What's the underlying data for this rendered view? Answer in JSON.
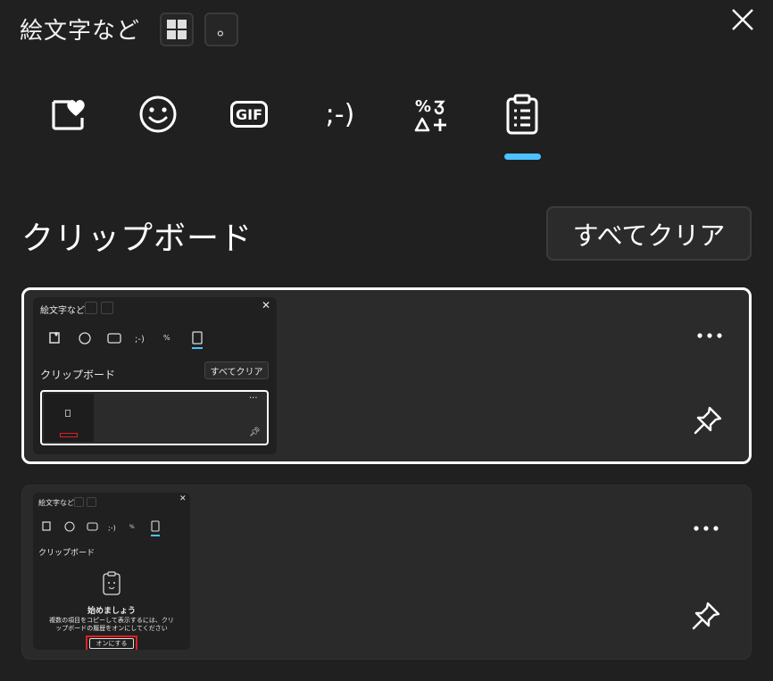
{
  "header": {
    "title": "絵文字など",
    "mode_button_2_glyph": "。"
  },
  "tabs": [
    {
      "name": "kaomoji-favorite",
      "icon": "heart-sticker-icon"
    },
    {
      "name": "emoji",
      "icon": "smiley-icon"
    },
    {
      "name": "gif",
      "icon": "gif-icon",
      "label": "GIF"
    },
    {
      "name": "kaomoji",
      "icon": "kaomoji-icon",
      "label": ";-)"
    },
    {
      "name": "symbols",
      "icon": "symbols-icon"
    },
    {
      "name": "clipboard",
      "icon": "clipboard-icon",
      "selected": true
    }
  ],
  "clipboard": {
    "section_title": "クリップボード",
    "clear_all_label": "すべてクリア"
  },
  "items": [
    {
      "thumbnail": {
        "title": "絵文字など",
        "section_title": "クリップボード",
        "clear_all_label": "すべてクリア",
        "gif_label": "GIF",
        "kaomoji_label": ";-)"
      }
    },
    {
      "thumbnail": {
        "title": "絵文字など",
        "section_title": "クリップボード",
        "gif_label": "GIF",
        "kaomoji_label": ";-)",
        "heading": "始めましょう",
        "message_line1": "複数の項目をコピーして表示するには、クリ",
        "message_line2": "ップボードの履歴をオンにしてください",
        "turn_on_label": "オンにする"
      }
    }
  ],
  "colors": {
    "background": "#202020",
    "accent": "#4cc2ff",
    "highlight_border": "#ffffff",
    "callout_red": "#e02020"
  }
}
